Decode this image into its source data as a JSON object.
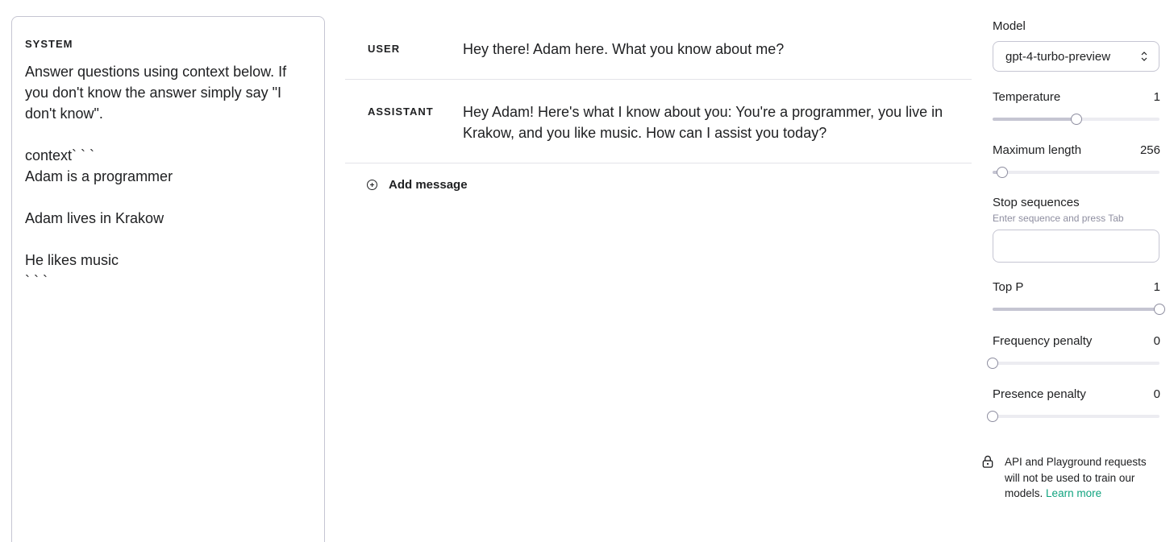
{
  "system": {
    "label": "SYSTEM",
    "content": "Answer questions using context below. If you don't know the answer simply say \"I don't know\".\n\ncontext` ` `\nAdam is a programmer\n\nAdam lives in Krakow\n\nHe likes music\n` ` `"
  },
  "messages": [
    {
      "role": "USER",
      "text": "Hey there! Adam here. What you know about me?"
    },
    {
      "role": "ASSISTANT",
      "text": "Hey Adam! Here's what I know about you: You're a programmer, you live in Krakow, and you like music. How can I assist you today?"
    }
  ],
  "add_message_label": "Add message",
  "settings": {
    "model_label": "Model",
    "model_value": "gpt-4-turbo-preview",
    "params": [
      {
        "key": "temperature",
        "label": "Temperature",
        "value": "1",
        "fraction": 0.5
      },
      {
        "key": "maximum-length",
        "label": "Maximum length",
        "value": "256",
        "fraction": 0.06
      },
      {
        "key": "top-p",
        "label": "Top P",
        "value": "1",
        "fraction": 1.0
      },
      {
        "key": "frequency-penalty",
        "label": "Frequency penalty",
        "value": "0",
        "fraction": 0.0
      },
      {
        "key": "presence-penalty",
        "label": "Presence penalty",
        "value": "0",
        "fraction": 0.0
      }
    ],
    "stop_sequences_label": "Stop sequences",
    "stop_sequences_hint": "Enter sequence and press Tab",
    "stop_sequences_value": ""
  },
  "privacy": {
    "text": "API and Playground requests will not be used to train our models.",
    "link": "Learn more"
  },
  "colors": {
    "accent": "#10a37f",
    "border": "#c5c5d2",
    "text": "#202123"
  }
}
